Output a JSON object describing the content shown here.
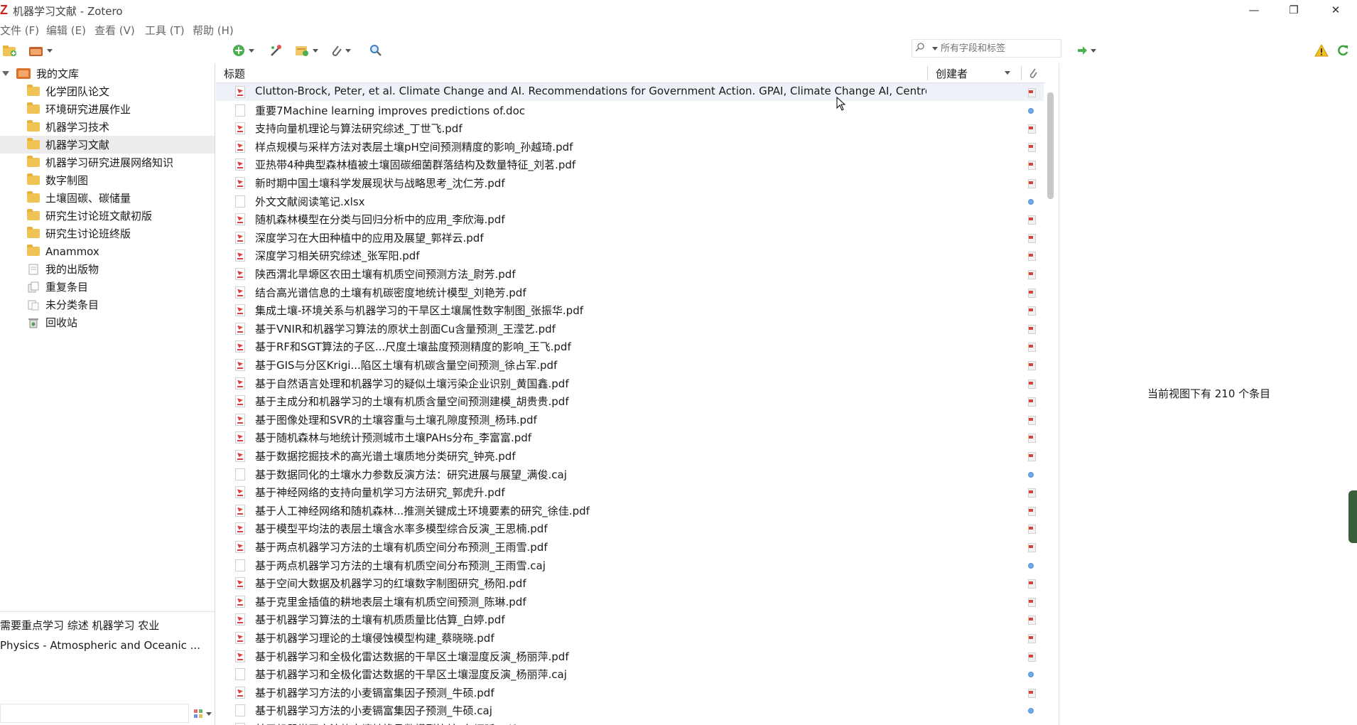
{
  "window": {
    "title": "机器学习文献 - Zotero",
    "minimize": "—",
    "restore": "❐",
    "close": "✕"
  },
  "menu": [
    "文件 (F)",
    "编辑 (E)",
    "查看 (V)",
    "工具 (T)",
    "帮助 (H)"
  ],
  "search": {
    "placeholder": "所有字段和标签"
  },
  "collections": [
    {
      "label": "我的文库",
      "kind": "library"
    },
    {
      "label": "化学团队论文",
      "kind": "folder"
    },
    {
      "label": "环境研究进展作业",
      "kind": "folder"
    },
    {
      "label": "机器学习技术",
      "kind": "folder"
    },
    {
      "label": "机器学习文献",
      "kind": "folder",
      "selected": true
    },
    {
      "label": "机器学习研究进展网络知识",
      "kind": "folder"
    },
    {
      "label": "数字制图",
      "kind": "folder"
    },
    {
      "label": "土壤固碳、碳储量",
      "kind": "folder"
    },
    {
      "label": "研究生讨论班文献初版",
      "kind": "folder"
    },
    {
      "label": "研究生讨论班终版",
      "kind": "folder"
    },
    {
      "label": "Anammox",
      "kind": "folder"
    },
    {
      "label": "我的出版物",
      "kind": "publications"
    },
    {
      "label": "重复条目",
      "kind": "duplicates"
    },
    {
      "label": "未分类条目",
      "kind": "unfiled"
    },
    {
      "label": "回收站",
      "kind": "trash"
    }
  ],
  "tags": {
    "line1": "需要重点学习 综述 机器学习  农业",
    "line2": "Physics - Atmospheric and Oceanic ..."
  },
  "columns": {
    "title": "标题",
    "creator": "创建者"
  },
  "items": [
    {
      "title": "Clutton-Brock, Peter, et al. Climate Change and AI. Recommendations for Government Action. GPAI, Climate Change AI, Centre f...",
      "type": "pdf",
      "att": "pdf",
      "selected": true
    },
    {
      "title": "重要7Machine learning improves predictions of.doc",
      "type": "doc",
      "att": "dot"
    },
    {
      "title": "支持向量机理论与算法研究综述_丁世飞.pdf",
      "type": "pdf",
      "att": "pdf"
    },
    {
      "title": "样点规模与采样方法对表层土壤pH空间预测精度的影响_孙越琦.pdf",
      "type": "pdf",
      "att": "pdf"
    },
    {
      "title": "亚热带4种典型森林植被土壤固碳细菌群落结构及数量特征_刘茗.pdf",
      "type": "pdf",
      "att": "pdf"
    },
    {
      "title": "新时期中国土壤科学发展现状与战略思考_沈仁芳.pdf",
      "type": "pdf",
      "att": "pdf"
    },
    {
      "title": "外文文献阅读笔记.xlsx",
      "type": "doc",
      "att": "dot"
    },
    {
      "title": "随机森林模型在分类与回归分析中的应用_李欣海.pdf",
      "type": "pdf",
      "att": "pdf"
    },
    {
      "title": "深度学习在大田种植中的应用及展望_郭祥云.pdf",
      "type": "pdf",
      "att": "pdf"
    },
    {
      "title": "深度学习相关研究综述_张军阳.pdf",
      "type": "pdf",
      "att": "pdf"
    },
    {
      "title": "陕西渭北旱塬区农田土壤有机质空间预测方法_尉芳.pdf",
      "type": "pdf",
      "att": "pdf"
    },
    {
      "title": "结合高光谱信息的土壤有机碳密度地统计模型_刘艳芳.pdf",
      "type": "pdf",
      "att": "pdf"
    },
    {
      "title": "集成土壤-环境关系与机器学习的干旱区土壤属性数字制图_张振华.pdf",
      "type": "pdf",
      "att": "pdf"
    },
    {
      "title": "基于VNIR和机器学习算法的原状土剖面Cu含量预测_王滢艺.pdf",
      "type": "pdf",
      "att": "pdf"
    },
    {
      "title": "基于RF和SGT算法的子区...尺度土壤盐度预测精度的影响_王飞.pdf",
      "type": "pdf",
      "att": "pdf"
    },
    {
      "title": "基于GIS与分区Krigi...陷区土壤有机碳含量空间预测_徐占军.pdf",
      "type": "pdf",
      "att": "pdf"
    },
    {
      "title": "基于自然语言处理和机器学习的疑似土壤污染企业识别_黄国鑫.pdf",
      "type": "pdf",
      "att": "pdf"
    },
    {
      "title": "基于主成分和机器学习的土壤有机质含量空间预测建模_胡贵贵.pdf",
      "type": "pdf",
      "att": "pdf"
    },
    {
      "title": "基于图像处理和SVR的土壤容重与土壤孔隙度预测_杨玮.pdf",
      "type": "pdf",
      "att": "pdf"
    },
    {
      "title": "基于随机森林与地统计预测城市土壤PAHs分布_李富富.pdf",
      "type": "pdf",
      "att": "pdf"
    },
    {
      "title": "基于数据挖掘技术的高光谱土壤质地分类研究_钟亮.pdf",
      "type": "pdf",
      "att": "pdf"
    },
    {
      "title": "基于数据同化的土壤水力参数反演方法：研究进展与展望_满俊.caj",
      "type": "doc",
      "att": "dot"
    },
    {
      "title": "基于神经网络的支持向量机学习方法研究_郭虎升.pdf",
      "type": "pdf",
      "att": "pdf"
    },
    {
      "title": "基于人工神经网络和随机森林...推测关键成土环境要素的研究_徐佳.pdf",
      "type": "pdf",
      "att": "pdf"
    },
    {
      "title": "基于模型平均法的表层土壤含水率多模型综合反演_王思楠.pdf",
      "type": "pdf",
      "att": "pdf"
    },
    {
      "title": "基于两点机器学习方法的土壤有机质空间分布预测_王雨雪.pdf",
      "type": "pdf",
      "att": "pdf"
    },
    {
      "title": "基于两点机器学习方法的土壤有机质空间分布预测_王雨雪.caj",
      "type": "doc",
      "att": "dot"
    },
    {
      "title": "基于空间大数据及机器学习的红壤数字制图研究_杨阳.pdf",
      "type": "pdf",
      "att": "pdf"
    },
    {
      "title": "基于克里金插值的耕地表层土壤有机质空间预测_陈琳.pdf",
      "type": "pdf",
      "att": "pdf"
    },
    {
      "title": "基于机器学习算法的土壤有机质质量比估算_白婷.pdf",
      "type": "pdf",
      "att": "pdf"
    },
    {
      "title": "基于机器学习理论的土壤侵蚀模型构建_蔡晓晓.pdf",
      "type": "pdf",
      "att": "pdf"
    },
    {
      "title": "基于机器学习和全极化雷达数据的干旱区土壤湿度反演_杨丽萍.pdf",
      "type": "pdf",
      "att": "pdf"
    },
    {
      "title": "基于机器学习和全极化雷达数据的干旱区土壤湿度反演_杨丽萍.caj",
      "type": "doc",
      "att": "dot"
    },
    {
      "title": "基于机器学习方法的小麦镉富集因子预测_牛硕.pdf",
      "type": "pdf",
      "att": "pdf"
    },
    {
      "title": "基于机器学习方法的小麦镉富集因子预测_牛硕.caj",
      "type": "doc",
      "att": "dot"
    },
    {
      "title": "基于机器学习方法的土壤转换函数模型比较_左炳昕.pdf",
      "type": "pdf",
      "att": "pdf"
    }
  ],
  "status": {
    "count": "当前视图下有 210 个条目"
  },
  "colors": {
    "folder": "#f0c454",
    "pdf_red": "#d94040",
    "attachment_dot": "#6da8e8",
    "selection": "#eef2f8"
  }
}
